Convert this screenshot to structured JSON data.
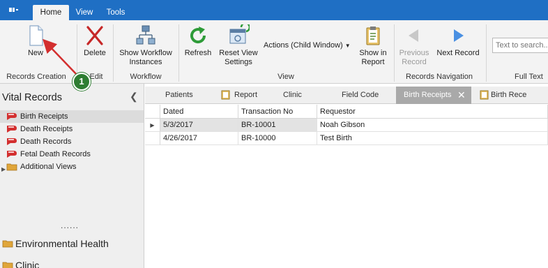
{
  "ribbon_tabs": [
    "Home",
    "View",
    "Tools"
  ],
  "buttons": {
    "new": "New",
    "delete": "Delete",
    "show_workflow": "Show Workflow Instances",
    "refresh": "Refresh",
    "reset_view": "Reset View Settings",
    "actions": "Actions (Child Window)",
    "show_in_report": "Show in Report",
    "previous_record": "Previous Record",
    "next_record": "Next Record"
  },
  "groups": {
    "records_creation": "Records Creation",
    "edit": "Edit",
    "workflow": "Workflow",
    "view": "View",
    "records_navigation": "Records Navigation",
    "full_text": "Full Text"
  },
  "search": {
    "placeholder": "Text to search..."
  },
  "nav": {
    "title": "Vital Records",
    "items": [
      {
        "label": "Birth Receipts",
        "selected": true
      },
      {
        "label": "Death Receipts"
      },
      {
        "label": "Death Records"
      },
      {
        "label": "Fetal Death Records"
      },
      {
        "label": "Additional Views"
      }
    ],
    "more": "......",
    "groups": [
      "Environmental Health",
      "Clinic"
    ]
  },
  "doc_tabs": [
    "Patients",
    "Report",
    "Clinic",
    "Field Code",
    "Birth Receipts",
    "Birth Rece"
  ],
  "grid": {
    "columns": [
      "Dated",
      "Transaction No",
      "Requestor"
    ],
    "rows": [
      [
        "5/3/2017",
        "BR-10001",
        "Noah Gibson"
      ],
      [
        "4/26/2017",
        "BR-10000",
        "Test Birth"
      ]
    ]
  },
  "annotation": "1",
  "colors": {
    "accent": "#1f6fc4",
    "callout": "#2e7d32",
    "arrow": "#d32f2f"
  }
}
